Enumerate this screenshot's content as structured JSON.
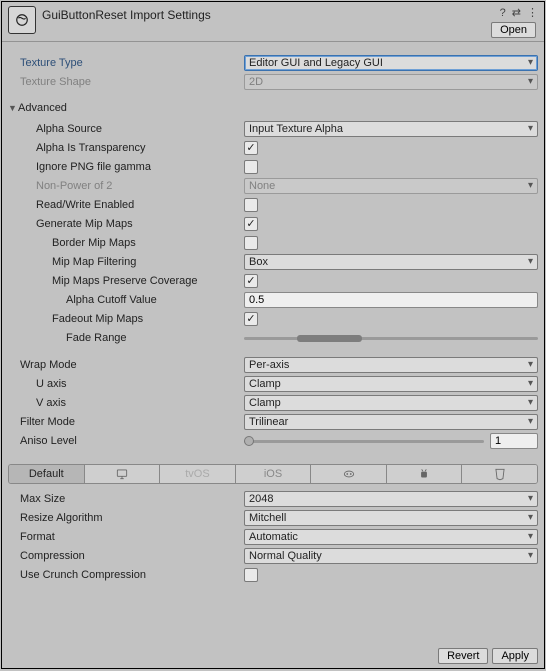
{
  "header": {
    "title": "GuiButtonReset Import Settings",
    "open_label": "Open"
  },
  "rows": {
    "texture_type": {
      "label": "Texture Type",
      "value": "Editor GUI and Legacy GUI"
    },
    "texture_shape": {
      "label": "Texture Shape",
      "value": "2D"
    },
    "advanced_label": "Advanced",
    "alpha_source": {
      "label": "Alpha Source",
      "value": "Input Texture Alpha"
    },
    "alpha_is_transparency": {
      "label": "Alpha Is Transparency",
      "checked": true
    },
    "ignore_png_gamma": {
      "label": "Ignore PNG file gamma",
      "checked": false
    },
    "non_power_of_2": {
      "label": "Non-Power of 2",
      "value": "None"
    },
    "read_write": {
      "label": "Read/Write Enabled",
      "checked": false
    },
    "generate_mipmaps": {
      "label": "Generate Mip Maps",
      "checked": true
    },
    "border_mipmaps": {
      "label": "Border Mip Maps",
      "checked": false
    },
    "mipmap_filtering": {
      "label": "Mip Map Filtering",
      "value": "Box"
    },
    "mipmaps_preserve_coverage": {
      "label": "Mip Maps Preserve Coverage",
      "checked": true
    },
    "alpha_cutoff": {
      "label": "Alpha Cutoff Value",
      "value": "0.5"
    },
    "fadeout_mipmaps": {
      "label": "Fadeout Mip Maps",
      "checked": true
    },
    "fade_range": {
      "label": "Fade Range"
    },
    "wrap_mode": {
      "label": "Wrap Mode",
      "value": "Per-axis"
    },
    "u_axis": {
      "label": "U axis",
      "value": "Clamp"
    },
    "v_axis": {
      "label": "V axis",
      "value": "Clamp"
    },
    "filter_mode": {
      "label": "Filter Mode",
      "value": "Trilinear"
    },
    "aniso_level": {
      "label": "Aniso Level",
      "value": "1"
    },
    "max_size": {
      "label": "Max Size",
      "value": "2048"
    },
    "resize_algorithm": {
      "label": "Resize Algorithm",
      "value": "Mitchell"
    },
    "format": {
      "label": "Format",
      "value": "Automatic"
    },
    "compression": {
      "label": "Compression",
      "value": "Normal Quality"
    },
    "use_crunch": {
      "label": "Use Crunch Compression",
      "checked": false
    }
  },
  "tabs": {
    "default": "Default",
    "tvos": "tvOS",
    "ios": "iOS"
  },
  "footer": {
    "revert": "Revert",
    "apply": "Apply"
  }
}
